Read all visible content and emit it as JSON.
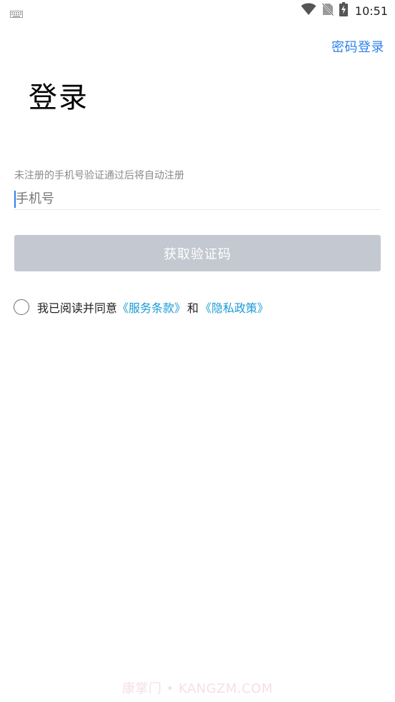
{
  "status_bar": {
    "time": "10:51",
    "icons": [
      "keyboard-icon",
      "wifi-icon",
      "no-sim-icon",
      "battery-charging-icon"
    ]
  },
  "header": {
    "password_login": "密码登录"
  },
  "main": {
    "title": "登录",
    "hint": "未注册的手机号验证通过后将自动注册",
    "phone_placeholder": "手机号",
    "phone_value": "",
    "get_code_label": "获取验证码"
  },
  "agreement": {
    "prefix": "我已阅读并同意",
    "terms_link": "《服务条款》",
    "and_text": "和",
    "privacy_link": "《隐私政策》",
    "checked": false
  },
  "watermark": "康掌门 • KANGZM.COM",
  "colors": {
    "link_blue": "#2f80ed",
    "agreement_link": "#1a9bd7",
    "button_disabled": "#c4c8d0"
  }
}
